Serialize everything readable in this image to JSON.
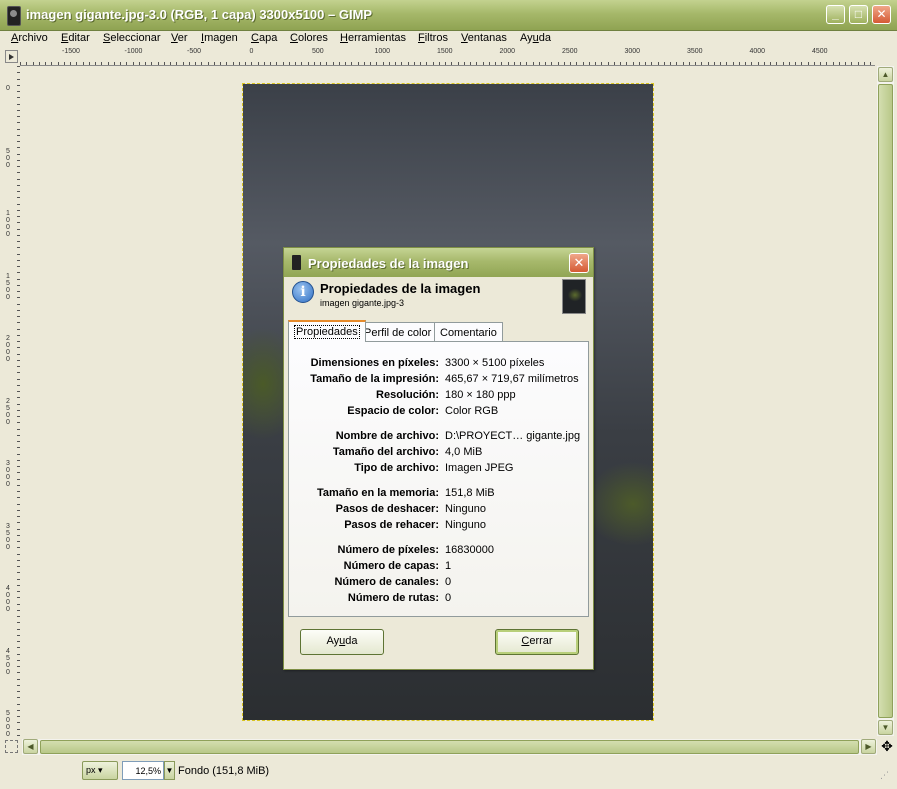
{
  "window": {
    "title": "imagen gigante.jpg-3.0 (RGB, 1 capa) 3300x5100 – GIMP",
    "minimize": "_",
    "maximize": "□",
    "close": "✕"
  },
  "menu": [
    {
      "pre": "",
      "u": "A",
      "post": "rchivo"
    },
    {
      "pre": "",
      "u": "E",
      "post": "ditar"
    },
    {
      "pre": "",
      "u": "S",
      "post": "eleccionar"
    },
    {
      "pre": "",
      "u": "V",
      "post": "er"
    },
    {
      "pre": "",
      "u": "I",
      "post": "magen"
    },
    {
      "pre": "",
      "u": "C",
      "post": "apa"
    },
    {
      "pre": "",
      "u": "C",
      "post": "olores"
    },
    {
      "pre": "",
      "u": "H",
      "post": "erramientas"
    },
    {
      "pre": "",
      "u": "F",
      "post": "iltros"
    },
    {
      "pre": "",
      "u": "V",
      "post": "entanas"
    },
    {
      "pre": "Ay",
      "u": "u",
      "post": "da"
    }
  ],
  "ruler": {
    "h_labels": [
      "-1500",
      "-1000",
      "-500",
      "0",
      "500",
      "1000",
      "1500",
      "2000",
      "2500",
      "3000",
      "3500",
      "4000",
      "4500"
    ],
    "v_labels": [
      "0",
      "500",
      "1000",
      "1500",
      "2000",
      "2500",
      "3000",
      "3500",
      "4000",
      "4500",
      "5000"
    ]
  },
  "status": {
    "unit": "px",
    "zoom": "12,5%",
    "text": "Fondo (151,8 MiB)"
  },
  "dialog": {
    "title": "Propiedades de la imagen",
    "header_title": "Propiedades de la imagen",
    "header_subtitle": "imagen gigante.jpg-3",
    "tabs": [
      "Propiedades",
      "Perfil de color",
      "Comentario"
    ],
    "rows": [
      {
        "label": "Dimensiones en píxeles:",
        "value": "3300 × 5100 píxeles"
      },
      {
        "label": "Tamaño de la impresión:",
        "value": "465,67 × 719,67 milímetros"
      },
      {
        "label": "Resolución:",
        "value": "180 × 180 ppp"
      },
      {
        "label": "Espacio de color:",
        "value": "Color RGB"
      },
      {
        "label": "Nombre de archivo:",
        "value": "D:\\PROYECT… gigante.jpg"
      },
      {
        "label": "Tamaño del archivo:",
        "value": "4,0 MiB"
      },
      {
        "label": "Tipo de archivo:",
        "value": "Imagen JPEG"
      },
      {
        "label": "Tamaño en la memoria:",
        "value": "151,8 MiB"
      },
      {
        "label": "Pasos de deshacer:",
        "value": "Ninguno"
      },
      {
        "label": "Pasos de rehacer:",
        "value": "Ninguno"
      },
      {
        "label": "Número de píxeles:",
        "value": "16830000"
      },
      {
        "label": "Número de capas:",
        "value": "1"
      },
      {
        "label": "Número de canales:",
        "value": "0"
      },
      {
        "label": "Número de rutas:",
        "value": "0"
      }
    ],
    "help_button": {
      "pre": "Ay",
      "u": "u",
      "post": "da"
    },
    "close_button": {
      "pre": "",
      "u": "C",
      "post": "errar"
    }
  }
}
